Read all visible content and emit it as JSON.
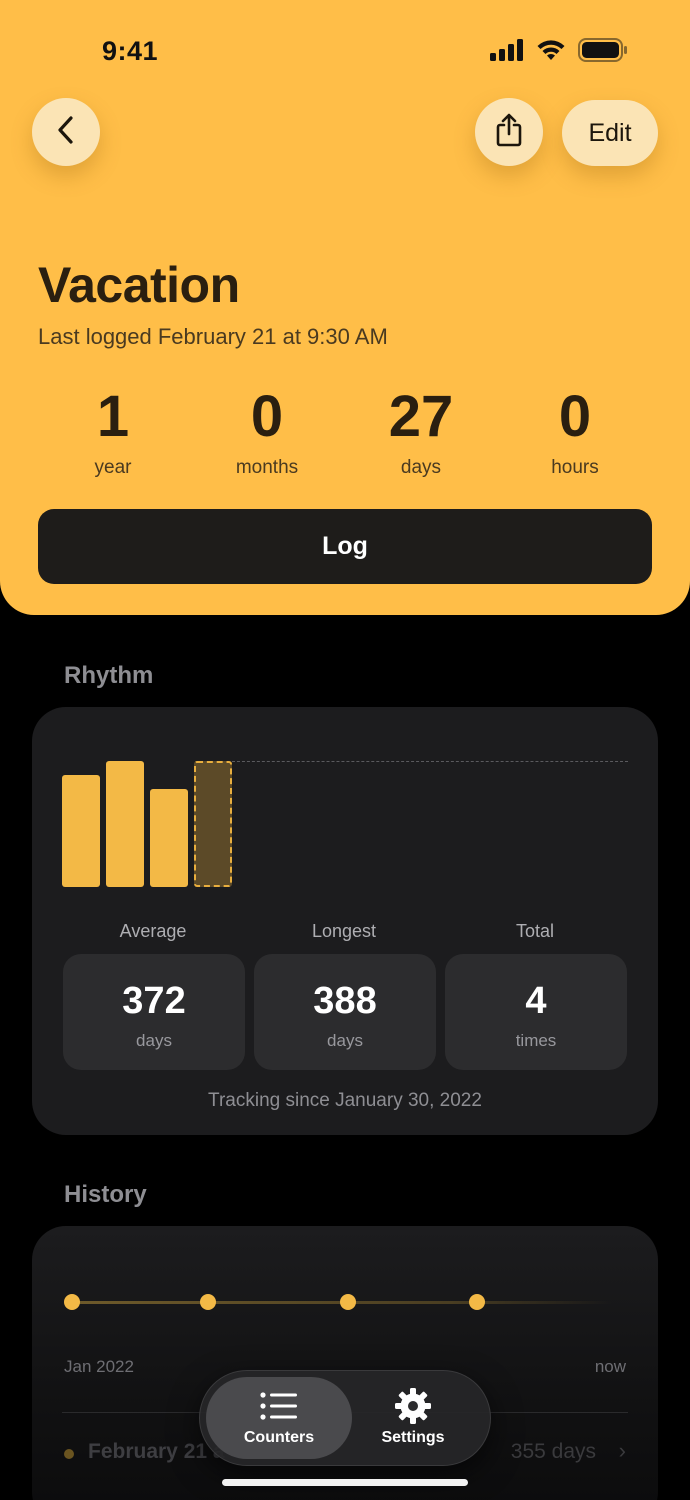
{
  "status_bar": {
    "time": "9:41"
  },
  "header": {
    "edit_label": "Edit",
    "title": "Vacation",
    "subtitle": "Last logged February 21 at 9:30 AM",
    "stats": [
      {
        "value": "1",
        "unit": "year"
      },
      {
        "value": "0",
        "unit": "months"
      },
      {
        "value": "27",
        "unit": "days"
      },
      {
        "value": "0",
        "unit": "hours"
      }
    ],
    "log_label": "Log"
  },
  "rhythm": {
    "section_label": "Rhythm",
    "metrics": [
      {
        "label": "Average",
        "value": "372",
        "unit": "days"
      },
      {
        "label": "Longest",
        "value": "388",
        "unit": "days"
      },
      {
        "label": "Total",
        "value": "4",
        "unit": "times"
      }
    ],
    "tracking_text": "Tracking since January 30, 2022"
  },
  "chart_data": {
    "type": "bar",
    "categories": [
      "1",
      "2",
      "3",
      "4"
    ],
    "values": [
      372,
      388,
      355,
      388
    ],
    "current_index": 3,
    "average": 372,
    "ylim": [
      0,
      400
    ]
  },
  "history": {
    "section_label": "History",
    "axis_start": "Jan 2022",
    "axis_end": "now",
    "timeline_points": 4,
    "rows": [
      {
        "date": "February 21 a",
        "duration": "355 days"
      }
    ]
  },
  "tabbar": {
    "tabs": [
      {
        "label": "Counters",
        "icon": "list-icon",
        "active": true
      },
      {
        "label": "Settings",
        "icon": "gear-icon",
        "active": false
      }
    ]
  },
  "colors": {
    "accent": "#FFBE48",
    "bar": "#F3B946",
    "card": "#1C1C1E",
    "background": "#000000"
  }
}
